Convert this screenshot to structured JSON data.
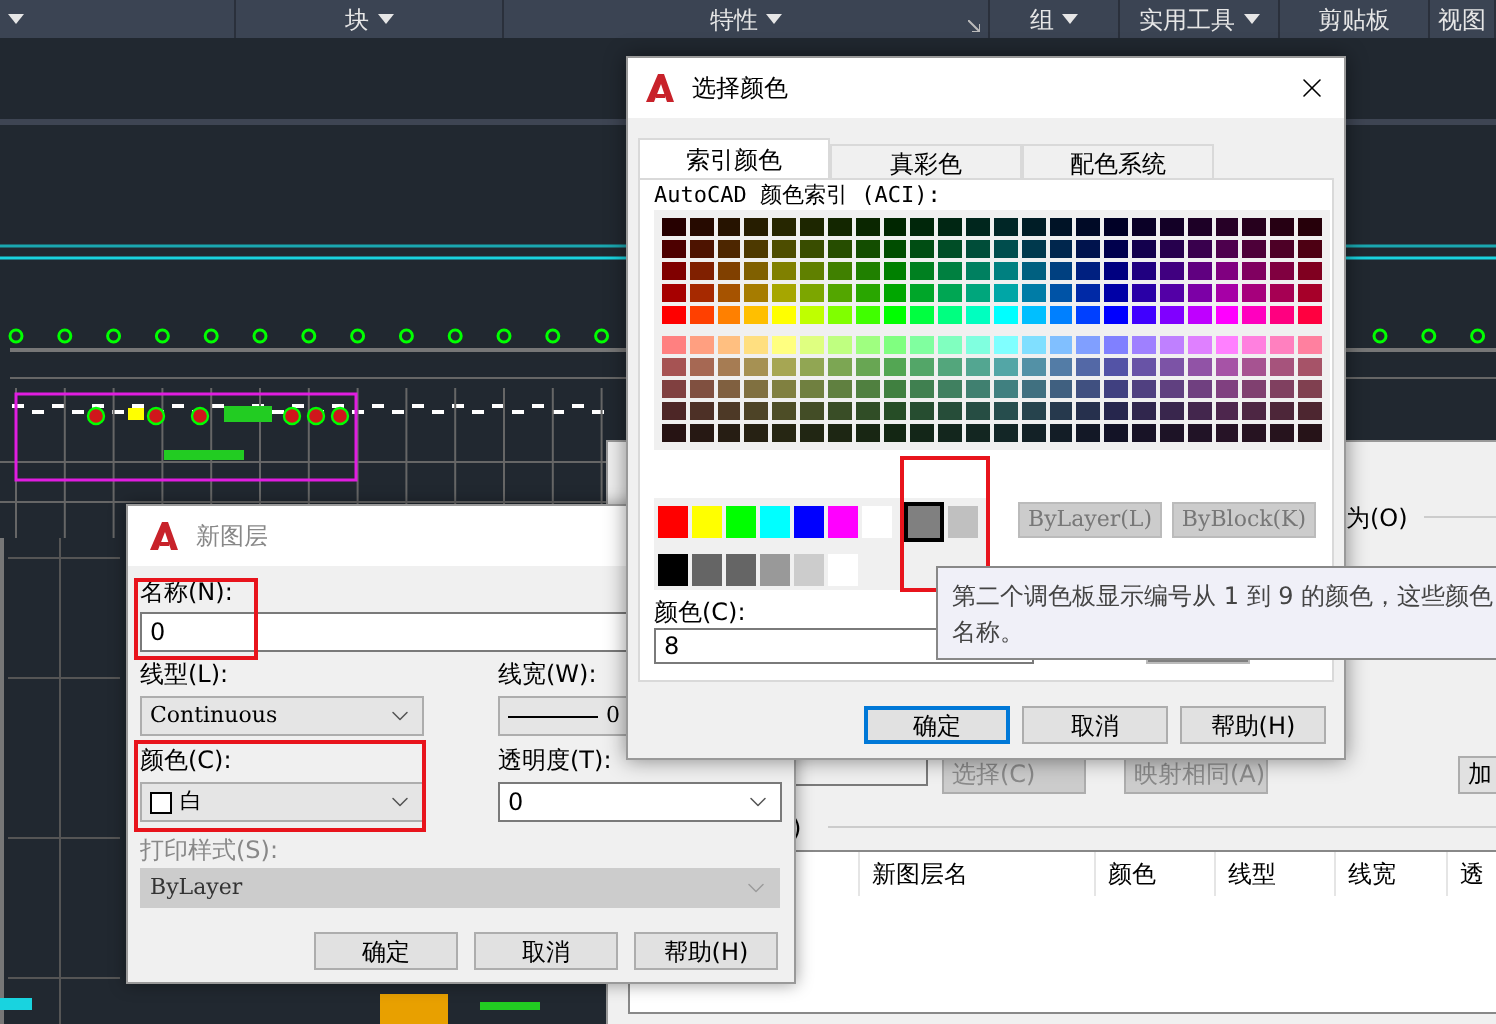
{
  "ribbon": {
    "panels": [
      {
        "label": "块",
        "has_menu": true,
        "has_launcher": false
      },
      {
        "label": "特性",
        "has_menu": true,
        "has_launcher": true
      },
      {
        "label": "组",
        "has_menu": true,
        "has_launcher": false
      },
      {
        "label": "实用工具",
        "has_menu": true,
        "has_launcher": false
      },
      {
        "label": "剪贴板",
        "has_menu": false,
        "has_launcher": false
      },
      {
        "label": "视图",
        "has_menu": false,
        "has_launcher": false
      }
    ]
  },
  "layer_dialog": {
    "option_label": "为(O)",
    "buttons": [
      {
        "label": "选择(C)",
        "disabled": true
      },
      {
        "label": "映射相同(A)",
        "disabled": true
      },
      {
        "label": "加",
        "disabled": false
      }
    ],
    "group_label_tail": ")",
    "table": {
      "columns": [
        "新图层名",
        "颜色",
        "线型",
        "线宽",
        "透"
      ]
    }
  },
  "new_layer_dialog": {
    "title": "新图层",
    "name": {
      "label": "名称(N):",
      "value": "0"
    },
    "linetype": {
      "label": "线型(L):",
      "value": "Continuous"
    },
    "lineweight": {
      "label": "线宽(W):",
      "value": "0"
    },
    "color": {
      "label": "颜色(C):",
      "value": "白"
    },
    "transparency": {
      "label": "透明度(T):",
      "value": "0"
    },
    "plot_style": {
      "label": "打印样式(S):",
      "value": "ByLayer",
      "disabled": true
    },
    "buttons": [
      "确定",
      "取消",
      "帮助(H)"
    ]
  },
  "select_color_dialog": {
    "title": "选择颜色",
    "tabs": [
      {
        "label": "索引颜色",
        "selected": true
      },
      {
        "label": "真彩色",
        "selected": false
      },
      {
        "label": "配色系统",
        "selected": false
      }
    ],
    "palette_label": "AutoCAD 颜色索引 (ACI):",
    "standard_colors": [
      {
        "color": "#ff0000",
        "selected": false
      },
      {
        "color": "#ffff00",
        "selected": false
      },
      {
        "color": "#00ff00",
        "selected": false
      },
      {
        "color": "#00ffff",
        "selected": false
      },
      {
        "color": "#0000ff",
        "selected": false
      },
      {
        "color": "#ff00ff",
        "selected": false
      },
      {
        "color": "#ffffff",
        "selected": false
      },
      {
        "color": "#808080",
        "selected": true
      },
      {
        "color": "#c0c0c0",
        "selected": false
      }
    ],
    "gray_colors": [
      {
        "color": "#000000"
      },
      {
        "color": "#656565"
      },
      {
        "color": "#656565"
      },
      {
        "color": "#999999"
      },
      {
        "color": "#cccccc"
      },
      {
        "color": "#ffffff"
      }
    ],
    "bylayer_button": "ByLayer(L)",
    "byblock_button": "ByBlock(K)",
    "color_field": {
      "label": "颜色(C):",
      "value": "8"
    },
    "buttons": [
      {
        "label": "确定",
        "default": true
      },
      {
        "label": "取消",
        "default": false
      },
      {
        "label": "帮助(H)",
        "default": false
      }
    ]
  },
  "tooltip": {
    "lines": [
      "第二个调色板显示编号从 1 到 9 的颜色，这些颜色",
      "名称。"
    ]
  }
}
